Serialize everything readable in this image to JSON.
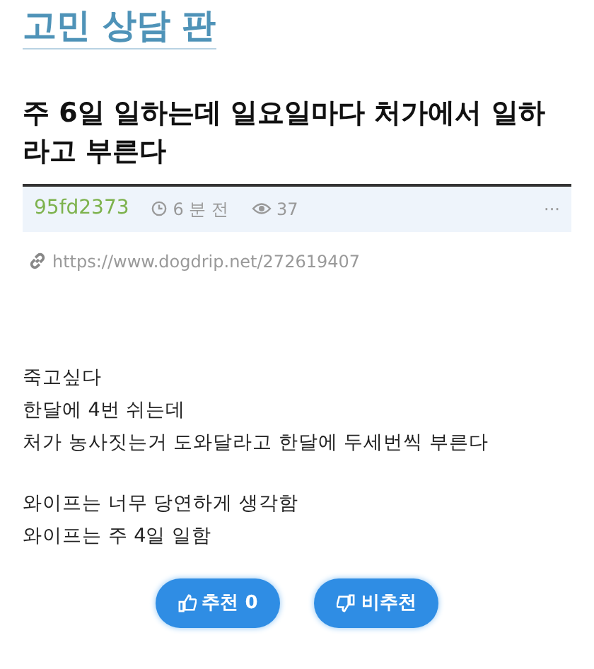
{
  "board": {
    "title": "고민 상담 판"
  },
  "post": {
    "title": "주 6일 일하는데 일요일마다 처가에서 일하라고 부른다",
    "author": "95fd2373",
    "time": "6 분 전",
    "views": "37",
    "more": "···",
    "url": "https://www.dogdrip.net/272619407",
    "paragraphs": [
      [
        "죽고싶다",
        "한달에 4번 쉬는데",
        "처가 농사짓는거 도와달라고 한달에 두세번씩 부른다"
      ],
      [
        "와이프는 너무 당연하게 생각함",
        "와이프는 주 4일 일함"
      ]
    ]
  },
  "votes": [
    {
      "kind": "up",
      "label": "추천 0"
    },
    {
      "kind": "down",
      "label": "비추천"
    }
  ]
}
